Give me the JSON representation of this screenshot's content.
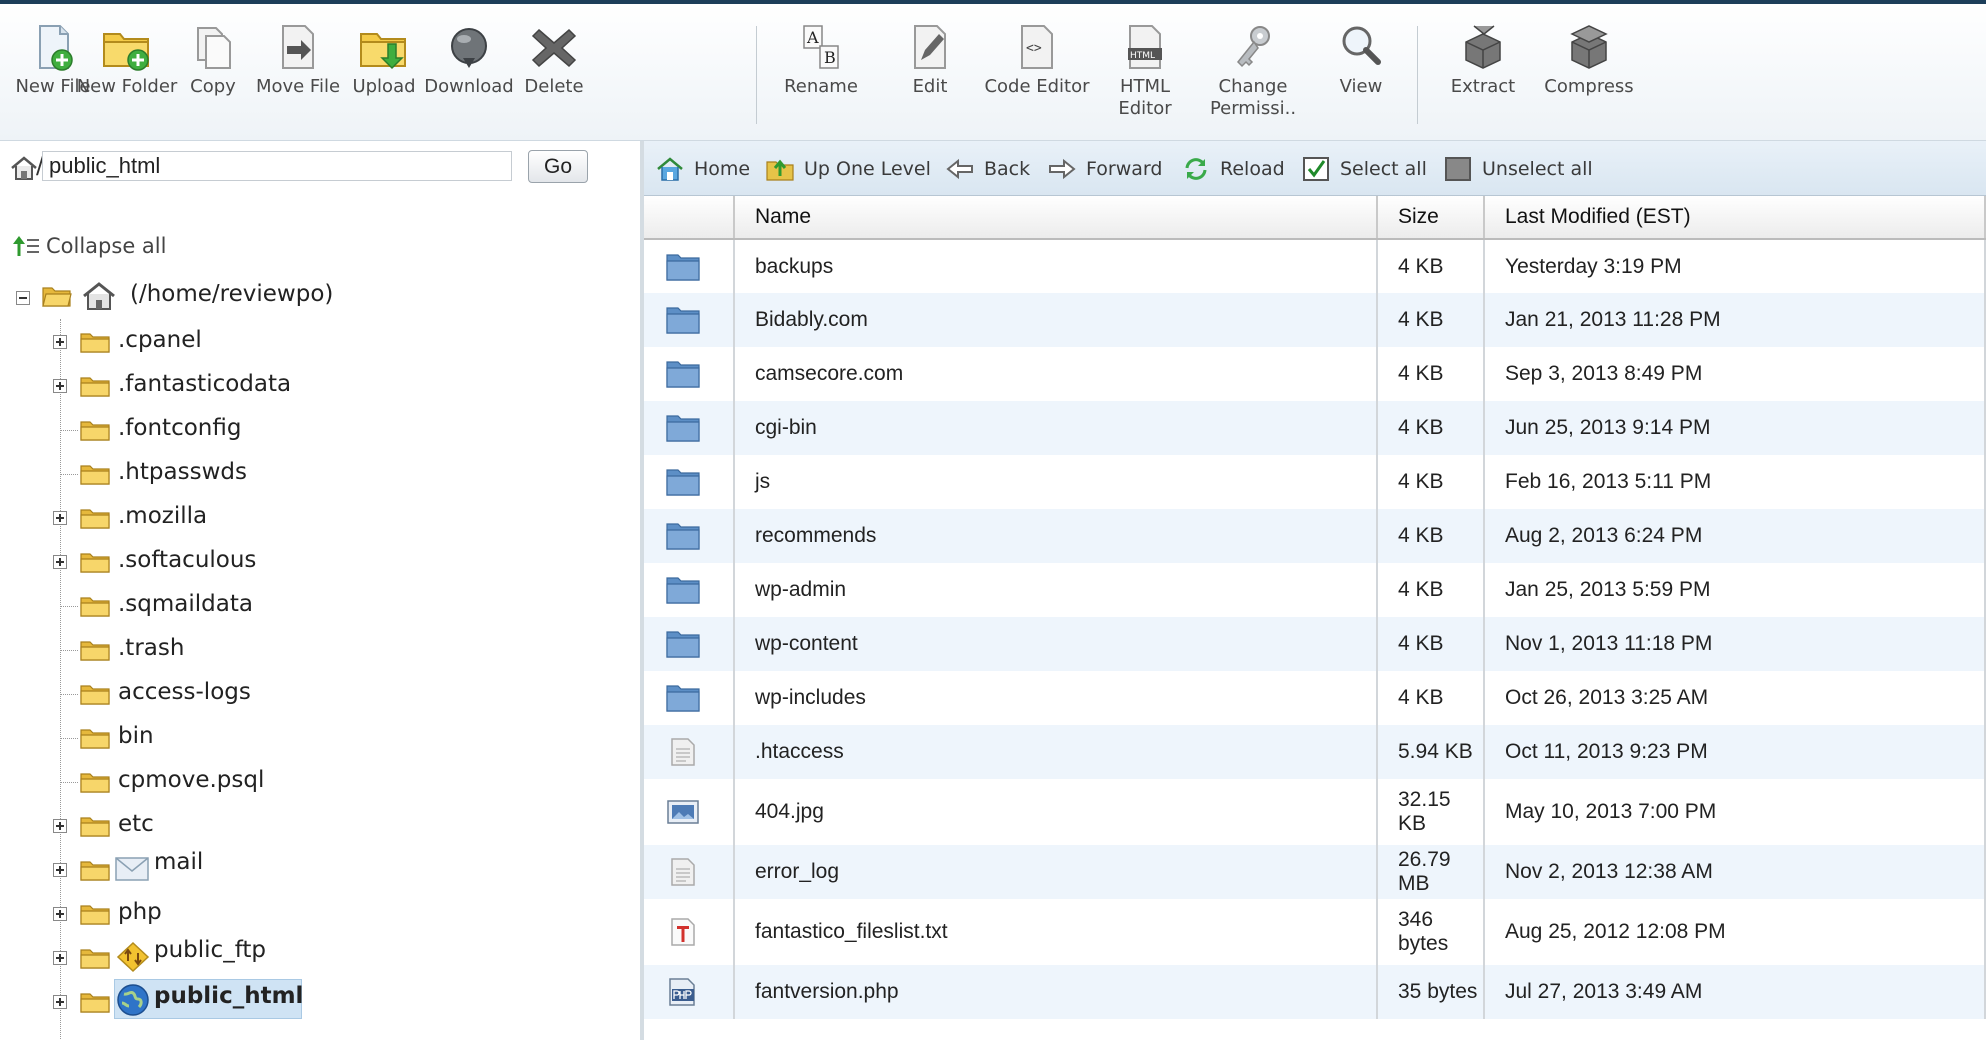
{
  "toolbar": {
    "items": [
      {
        "label": "New File",
        "icon": "new-file-icon"
      },
      {
        "label": "New Folder",
        "icon": "new-folder-icon"
      },
      {
        "label": "Copy",
        "icon": "copy-icon"
      },
      {
        "label": "Move File",
        "icon": "move-file-icon"
      },
      {
        "label": "Upload",
        "icon": "upload-icon"
      },
      {
        "label": "Download",
        "icon": "download-icon"
      },
      {
        "label": "Delete",
        "icon": "delete-icon"
      },
      {
        "label": "Rename",
        "icon": "rename-icon"
      },
      {
        "label": "Edit",
        "icon": "edit-icon"
      },
      {
        "label": "Code Editor",
        "icon": "code-editor-icon"
      },
      {
        "label": "HTML Editor",
        "icon": "html-editor-icon"
      },
      {
        "label": "Change Permissi..",
        "icon": "permissions-key-icon"
      },
      {
        "label": "View",
        "icon": "magnifier-icon"
      },
      {
        "label": "Extract",
        "icon": "extract-icon"
      },
      {
        "label": "Compress",
        "icon": "compress-icon"
      }
    ]
  },
  "path": {
    "separator": "/",
    "value": "public_html",
    "go_label": "Go"
  },
  "tree": {
    "collapse_label": "Collapse all",
    "root_label": "(/home/reviewpo)",
    "items": [
      {
        "label": ".cpanel"
      },
      {
        "label": ".fantasticodata"
      },
      {
        "label": ".fontconfig"
      },
      {
        "label": ".htpasswds"
      },
      {
        "label": ".mozilla"
      },
      {
        "label": ".softaculous"
      },
      {
        "label": ".sqmaildata"
      },
      {
        "label": ".trash"
      },
      {
        "label": "access-logs"
      },
      {
        "label": "bin"
      },
      {
        "label": "cpmove.psql"
      },
      {
        "label": "etc"
      },
      {
        "label": "mail"
      },
      {
        "label": "php"
      },
      {
        "label": "public_ftp"
      },
      {
        "label": "public_html"
      }
    ]
  },
  "nav": {
    "home": "Home",
    "up": "Up One Level",
    "back": "Back",
    "forward": "Forward",
    "reload": "Reload",
    "select_all": "Select all",
    "unselect_all": "Unselect all"
  },
  "table": {
    "headers": {
      "name": "Name",
      "size": "Size",
      "modified": "Last Modified (EST)"
    },
    "rows": [
      {
        "name": "backups",
        "size": "4 KB",
        "modified": "Yesterday 3:19 PM",
        "type": "folder"
      },
      {
        "name": "Bidably.com",
        "size": "4 KB",
        "modified": "Jan 21, 2013 11:28 PM",
        "type": "folder"
      },
      {
        "name": "camsecore.com",
        "size": "4 KB",
        "modified": "Sep 3, 2013 8:49 PM",
        "type": "folder"
      },
      {
        "name": "cgi-bin",
        "size": "4 KB",
        "modified": "Jun 25, 2013 9:14 PM",
        "type": "folder"
      },
      {
        "name": "js",
        "size": "4 KB",
        "modified": "Feb 16, 2013 5:11 PM",
        "type": "folder"
      },
      {
        "name": "recommends",
        "size": "4 KB",
        "modified": "Aug 2, 2013 6:24 PM",
        "type": "folder"
      },
      {
        "name": "wp-admin",
        "size": "4 KB",
        "modified": "Jan 25, 2013 5:59 PM",
        "type": "folder"
      },
      {
        "name": "wp-content",
        "size": "4 KB",
        "modified": "Nov 1, 2013 11:18 PM",
        "type": "folder"
      },
      {
        "name": "wp-includes",
        "size": "4 KB",
        "modified": "Oct 26, 2013 3:25 AM",
        "type": "folder"
      },
      {
        "name": ".htaccess",
        "size": "5.94 KB",
        "modified": "Oct 11, 2013 9:23 PM",
        "type": "text"
      },
      {
        "name": "404.jpg",
        "size": "32.15 KB",
        "modified": "May 10, 2013 7:00 PM",
        "type": "image"
      },
      {
        "name": "error_log",
        "size": "26.79 MB",
        "modified": "Nov 2, 2013 12:38 AM",
        "type": "text"
      },
      {
        "name": "fantastico_fileslist.txt",
        "size": "346 bytes",
        "modified": "Aug 25, 2012 12:08 PM",
        "type": "txt"
      },
      {
        "name": "fantversion.php",
        "size": "35 bytes",
        "modified": "Jul 27, 2013 3:49 AM",
        "type": "php"
      }
    ]
  }
}
